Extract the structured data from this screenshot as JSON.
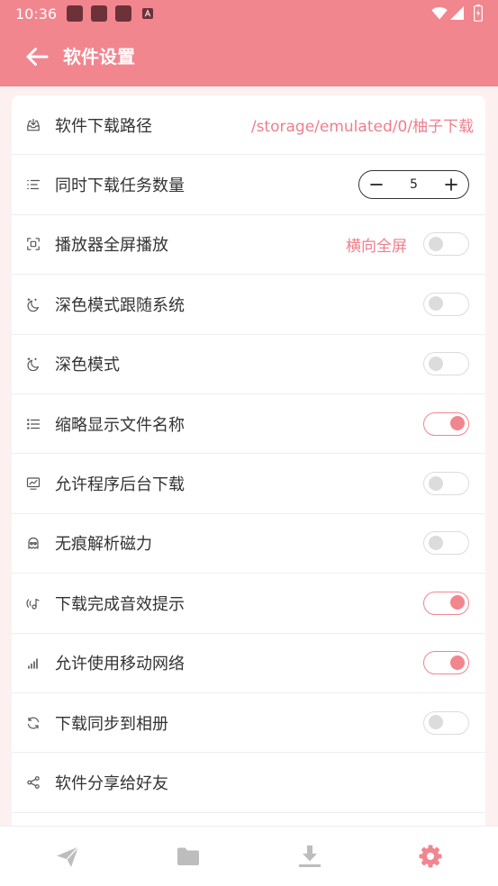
{
  "status_bar": {
    "time": "10:36",
    "notification_icons": [
      "app-notification-icon",
      "app-notification-icon",
      "app-notification-icon",
      "a-notification-icon"
    ],
    "system_icons": [
      "wifi-icon",
      "cell-signal-icon",
      "battery-charging-icon"
    ]
  },
  "app_bar": {
    "back_icon": "arrow-left-icon",
    "title": "软件设置"
  },
  "settings": [
    {
      "label": "软件下载路径",
      "icon": "inbox-download-icon",
      "value": "/storage/emulated/0/柚子下载"
    },
    {
      "label": "同时下载任务数量",
      "icon": "list-icon",
      "stepper_value": 5
    },
    {
      "label": "播放器全屏播放",
      "icon": "fullscreen-icon",
      "value": "横向全屏",
      "toggle_on": false
    },
    {
      "label": "深色模式跟随系统",
      "icon": "moon-stars-icon",
      "toggle_on": false
    },
    {
      "label": "深色模式",
      "icon": "moon-stars-icon",
      "toggle_on": false
    },
    {
      "label": "缩略显示文件名称",
      "icon": "list-bullet-icon",
      "toggle_on": true
    },
    {
      "label": "允许程序后台下载",
      "icon": "monitor-chart-icon",
      "toggle_on": false
    },
    {
      "label": "无痕解析磁力",
      "icon": "incognito-icon",
      "toggle_on": false
    },
    {
      "label": "下载完成音效提示",
      "icon": "sound-note-icon",
      "toggle_on": true
    },
    {
      "label": "允许使用移动网络",
      "icon": "mobile-signal-icon",
      "toggle_on": true
    },
    {
      "label": "下载同步到相册",
      "icon": "sync-icon",
      "toggle_on": false
    },
    {
      "label": "软件分享给好友",
      "icon": "share-icon"
    }
  ],
  "bottom_nav": [
    {
      "icon": "send-icon",
      "active": false
    },
    {
      "icon": "folder-icon",
      "active": false
    },
    {
      "icon": "download-icon",
      "active": false
    },
    {
      "icon": "settings-gear-icon",
      "active": true
    }
  ],
  "colors": {
    "primary": "#f1868f",
    "accent_text": "#ee7f8b",
    "page_background": "#fdf0f1",
    "inactive_icon": "#bdbdbd",
    "toggle_off": "#dcdcdc"
  }
}
